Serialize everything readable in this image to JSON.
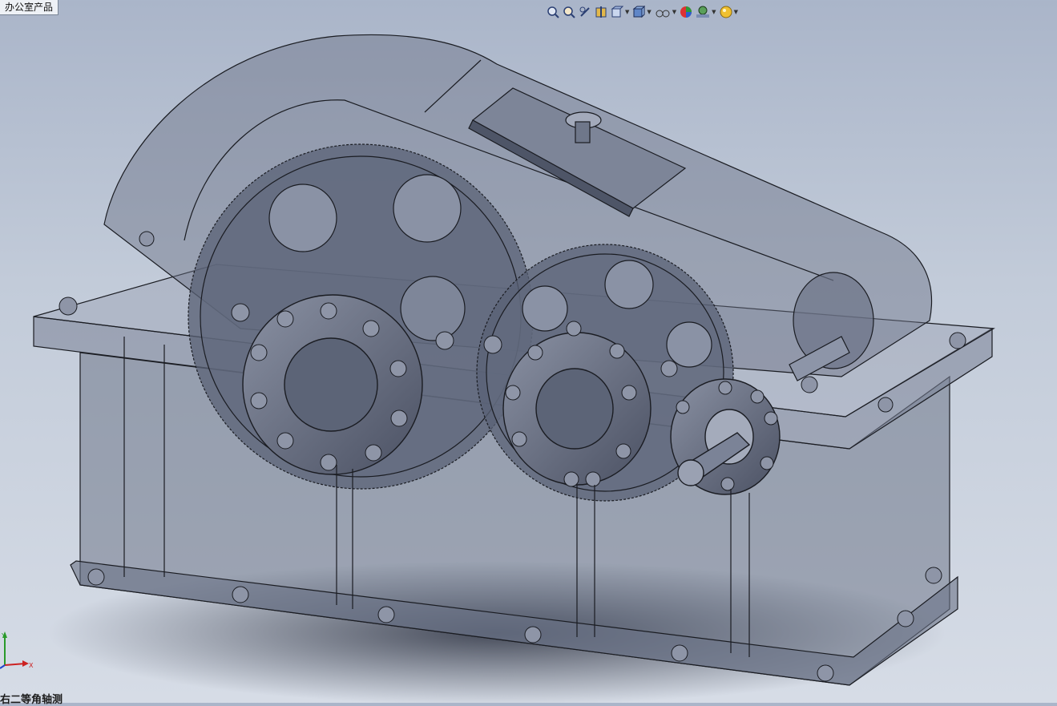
{
  "window": {
    "tab_label": "办公室产品"
  },
  "toolbar": {
    "items": [
      {
        "name": "zoom-to-fit-icon"
      },
      {
        "name": "zoom-to-area-icon"
      },
      {
        "name": "previous-view-icon"
      },
      {
        "name": "section-view-icon"
      },
      {
        "name": "view-orientation-icon"
      },
      {
        "name": "display-style-icon"
      },
      {
        "name": "hide-show-items-icon"
      },
      {
        "name": "edit-appearance-icon"
      },
      {
        "name": "apply-scene-icon"
      },
      {
        "name": "view-settings-icon"
      }
    ]
  },
  "triad": {
    "x_label": "X",
    "y_label": "Y"
  },
  "view": {
    "orientation_label": "右二等角轴测"
  },
  "colors": {
    "background_top": "#aab5c9",
    "body_fill": "#5a6275",
    "edge": "#1a1c22"
  }
}
